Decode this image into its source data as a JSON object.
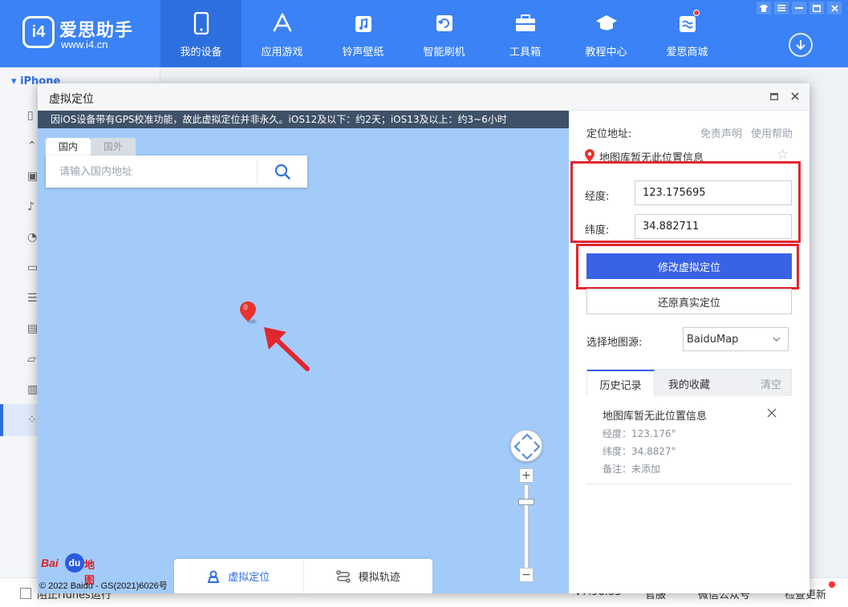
{
  "app": {
    "name": "爱思助手",
    "url": "www.i4.cn",
    "logo_text": "i4"
  },
  "nav": {
    "items": [
      {
        "label": "我的设备",
        "icon": "phone-icon"
      },
      {
        "label": "应用游戏",
        "icon": "app-store-icon"
      },
      {
        "label": "铃声壁纸",
        "icon": "music-icon"
      },
      {
        "label": "智能刷机",
        "icon": "refresh-icon"
      },
      {
        "label": "工具箱",
        "icon": "toolbox-icon"
      },
      {
        "label": "教程中心",
        "icon": "graduation-cap-icon"
      },
      {
        "label": "爱思商城",
        "icon": "store-icon"
      }
    ],
    "active_index": 0
  },
  "sidebar": {
    "device_name": "iPhone",
    "item_icons": [
      "phone-icon",
      "app-icon",
      "image-icon",
      "music-icon",
      "bell-icon",
      "video-icon",
      "book-icon",
      "toolbox-icon",
      "folder-icon",
      "document-icon",
      "grid-icon"
    ]
  },
  "statusbar": {
    "itunes_label": "阻止iTunes运行",
    "version": "V7.98.33",
    "feedback": "官服",
    "wechat": "微信公众号",
    "update": "检查更新"
  },
  "dialog": {
    "title": "虚拟定位",
    "notice": "因iOS设备带有GPS校准功能，故此虚拟定位并非永久。iOS12及以下：约2天；iOS13及以上：约3~6小时",
    "region_tabs": {
      "domestic": "国内",
      "foreign": "国外"
    },
    "search_placeholder": "请输入国内地址",
    "mode_tabs": {
      "virtual": "虚拟定位",
      "track": "模拟轨迹"
    },
    "baidu": {
      "bai": "Bai",
      "du": "du",
      "map": "地图"
    },
    "copyright": "© 2022 Baidu - GS(2021)6026号",
    "panel": {
      "location_label": "定位地址:",
      "disclaimer_link": "免责声明",
      "help_link": "使用帮助",
      "location_text": "地图库暂无此位置信息",
      "longitude_label": "经度:",
      "longitude_value": "123.175695",
      "latitude_label": "纬度:",
      "latitude_value": "34.882711",
      "modify_button": "修改虚拟定位",
      "restore_button": "还原真实定位",
      "map_source_label": "选择地图源:",
      "map_source_value": "BaiduMap",
      "tabs": {
        "history": "历史记录",
        "favorites": "我的收藏",
        "clear": "清空"
      },
      "history": [
        {
          "title": "地图库暂无此位置信息",
          "longitude": "经度：123.176°",
          "latitude": "纬度：34.8827°",
          "note": "备注：未添加"
        }
      ]
    }
  },
  "colors": {
    "brand_blue": "#3a82f5",
    "primary_button": "#3a62e6",
    "highlight_red": "#e0262f",
    "map_water": "#a3cbf9",
    "pin_red": "#e8322e"
  }
}
